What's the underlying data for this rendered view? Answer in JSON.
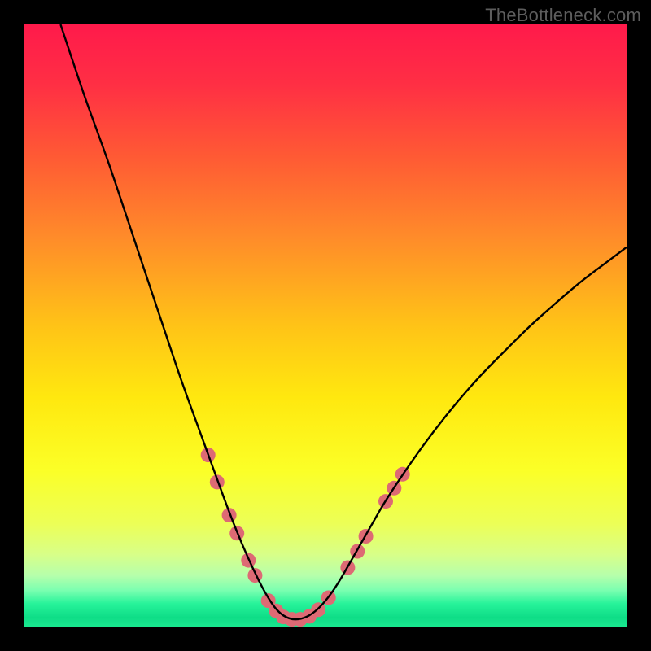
{
  "watermark": "TheBottleneck.com",
  "chart_data": {
    "type": "line",
    "title": "",
    "xlabel": "",
    "ylabel": "",
    "xlim": [
      0,
      100
    ],
    "ylim": [
      0,
      100
    ],
    "grid": false,
    "legend": false,
    "description": "Bottleneck V-curve over vertical rainbow gradient (red top to green bottom). Y-axis is bottleneck percentage (0 at bottom, 100 at top). Curve dips to ~0 near x≈44 and rises toward both sides.",
    "gradient_stops": [
      {
        "offset": 0.0,
        "color": "#ff1a4b"
      },
      {
        "offset": 0.1,
        "color": "#ff2f44"
      },
      {
        "offset": 0.22,
        "color": "#ff5a34"
      },
      {
        "offset": 0.35,
        "color": "#ff8a2a"
      },
      {
        "offset": 0.5,
        "color": "#ffc317"
      },
      {
        "offset": 0.62,
        "color": "#ffe80f"
      },
      {
        "offset": 0.74,
        "color": "#fbff27"
      },
      {
        "offset": 0.83,
        "color": "#ecff57"
      },
      {
        "offset": 0.88,
        "color": "#d8ff88"
      },
      {
        "offset": 0.915,
        "color": "#b6ffab"
      },
      {
        "offset": 0.94,
        "color": "#7affb0"
      },
      {
        "offset": 0.962,
        "color": "#27f39a"
      },
      {
        "offset": 0.985,
        "color": "#0edd87"
      },
      {
        "offset": 1.0,
        "color": "#19e78f"
      }
    ],
    "series": [
      {
        "name": "bottleneck-curve",
        "color": "#000000",
        "x": [
          6,
          8,
          10,
          12,
          14,
          16,
          18,
          20,
          22,
          24,
          26,
          28,
          30,
          32,
          34,
          36,
          38,
          40,
          42,
          44,
          46,
          48,
          50,
          52,
          54,
          56,
          58,
          60,
          64,
          68,
          72,
          76,
          80,
          84,
          88,
          92,
          96,
          100
        ],
        "y": [
          100,
          94,
          88,
          82.5,
          77,
          71,
          65,
          59,
          53,
          47,
          41,
          35.5,
          30,
          24.5,
          19,
          14,
          9.5,
          5.5,
          2.5,
          1.2,
          1.2,
          2.2,
          4.2,
          7,
          10.5,
          14,
          17.5,
          21,
          27,
          32.5,
          37.5,
          42,
          46,
          50,
          53.5,
          57,
          60,
          63
        ]
      }
    ],
    "markers": {
      "color": "#dd6a74",
      "radius_px": 9,
      "points": [
        {
          "x": 30.5,
          "y": 28.5
        },
        {
          "x": 32.0,
          "y": 24.0
        },
        {
          "x": 34.0,
          "y": 18.5
        },
        {
          "x": 35.3,
          "y": 15.5
        },
        {
          "x": 37.2,
          "y": 11.0
        },
        {
          "x": 38.3,
          "y": 8.5
        },
        {
          "x": 40.5,
          "y": 4.3
        },
        {
          "x": 41.8,
          "y": 2.6
        },
        {
          "x": 43.0,
          "y": 1.6
        },
        {
          "x": 44.4,
          "y": 1.2
        },
        {
          "x": 45.8,
          "y": 1.2
        },
        {
          "x": 47.3,
          "y": 1.7
        },
        {
          "x": 48.8,
          "y": 2.8
        },
        {
          "x": 50.5,
          "y": 4.8
        },
        {
          "x": 53.7,
          "y": 9.8
        },
        {
          "x": 55.3,
          "y": 12.5
        },
        {
          "x": 56.7,
          "y": 15.0
        },
        {
          "x": 60.0,
          "y": 20.8
        },
        {
          "x": 61.4,
          "y": 23.0
        },
        {
          "x": 62.8,
          "y": 25.3
        }
      ]
    }
  }
}
